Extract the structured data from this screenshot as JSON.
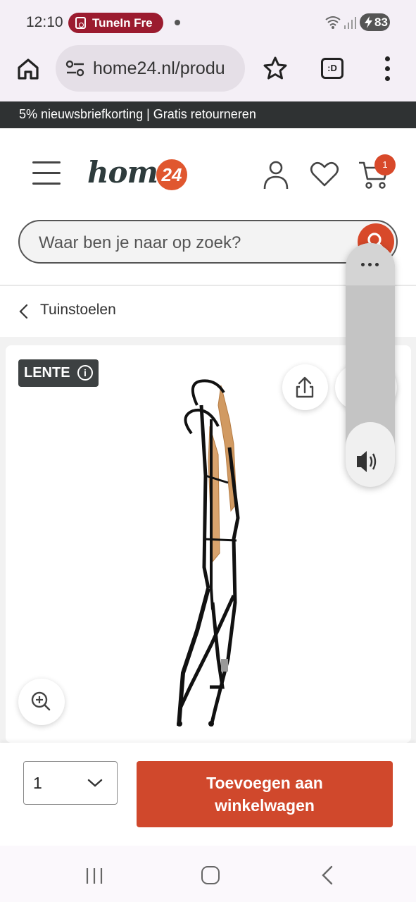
{
  "status_bar": {
    "time": "12:10",
    "media_pill_label": "TuneIn Fre",
    "battery_level": "83"
  },
  "browser": {
    "url": "home24.nl/produ",
    "extension_label": ":D"
  },
  "promo_banner": {
    "text": "5% nieuwsbriefkorting | Gratis retourneren"
  },
  "header": {
    "logo_text": "home",
    "logo_badge": "24",
    "cart_count": "1"
  },
  "search": {
    "placeholder": "Waar ben je naar op zoek?"
  },
  "breadcrumb": {
    "label": "Tuinstoelen"
  },
  "product": {
    "badge_label": "LENTE",
    "badge_info": "i"
  },
  "purchase": {
    "quantity": "1",
    "add_to_cart_line1": "Toevoegen aan",
    "add_to_cart_line2": "winkelwagen"
  },
  "colors": {
    "brand_accent": "#d8492a",
    "promo_bg": "#2f3233",
    "browser_chrome": "#f4eff6",
    "media_pill": "#9b1b2f"
  },
  "icons": [
    "home-icon",
    "tune-icon",
    "star-icon",
    "more-vert-icon",
    "menu-icon",
    "account-icon",
    "heart-icon",
    "cart-icon",
    "search-icon",
    "chevron-left-icon",
    "info-icon",
    "share-icon",
    "zoom-in-icon",
    "speaker-icon",
    "chevron-down-icon"
  ]
}
